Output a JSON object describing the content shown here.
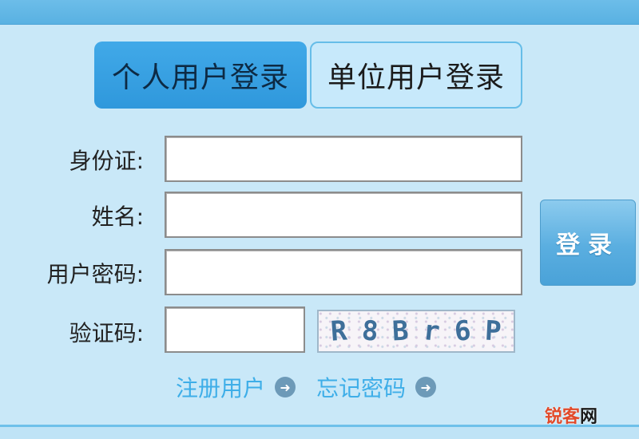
{
  "tabs": [
    {
      "label": "个人用户登录",
      "active": true
    },
    {
      "label": "单位用户登录",
      "active": false
    }
  ],
  "form": {
    "id_card_label": "身份证:",
    "id_card_value": "",
    "name_label": "姓名:",
    "name_value": "",
    "password_label": "用户密码:",
    "password_value": "",
    "captcha_label": "验证码:",
    "captcha_value": ""
  },
  "captcha_image": {
    "chars": [
      "R",
      "8",
      "B",
      "r",
      "6",
      "P"
    ]
  },
  "login_button": {
    "label": "登录"
  },
  "links": {
    "register": "注册用户",
    "forgot_password": "忘记密码"
  },
  "watermark": {
    "part1": "锐客",
    "part2": "网"
  },
  "colors": {
    "background": "#c9e8f8",
    "tab_active": "#2f98dc",
    "link": "#3eaee8",
    "login_button": "#5aaee0"
  },
  "icons": {
    "link_arrow": "circle-arrow-right-icon"
  }
}
